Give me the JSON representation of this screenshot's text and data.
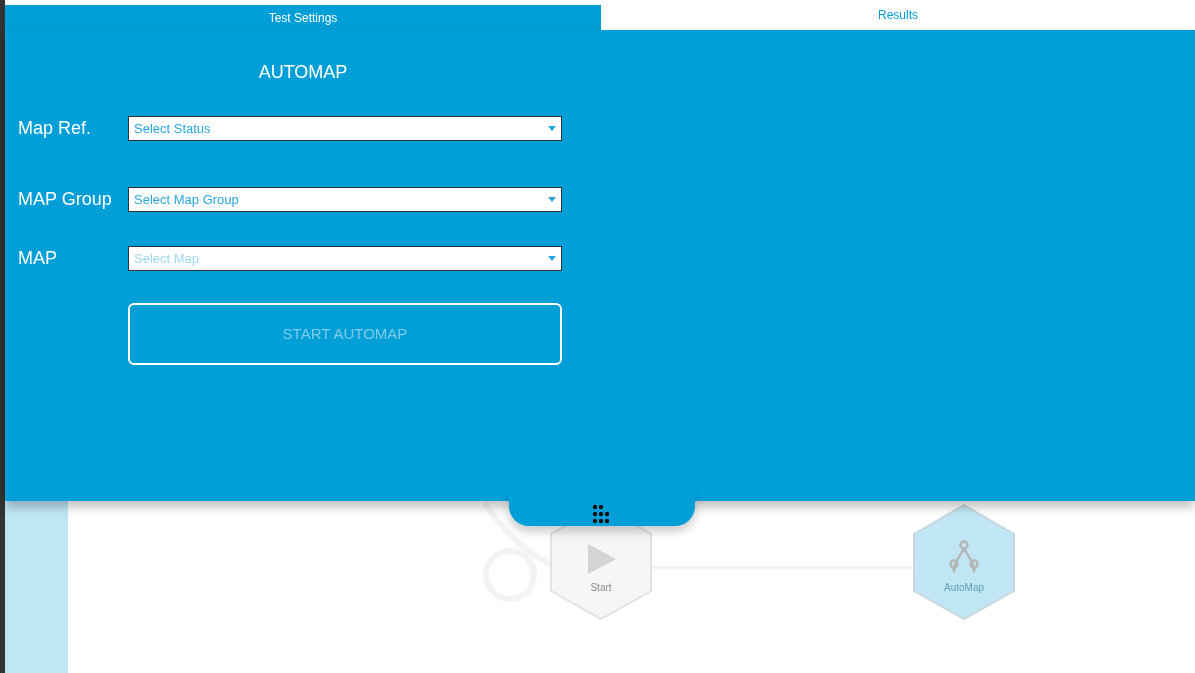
{
  "tabs": [
    {
      "label": "Test Settings",
      "selected": true
    },
    {
      "label": "Results",
      "selected": false
    }
  ],
  "panel": {
    "title": "AUTOMAP",
    "fields": [
      {
        "label": "Map Ref.",
        "placeholder": "Select Status",
        "disabled": false
      },
      {
        "label": "MAP Group",
        "placeholder": "Select Map Group",
        "disabled": false
      },
      {
        "label": "MAP",
        "placeholder": "Select Map",
        "disabled": true
      }
    ],
    "button": {
      "label": "START AUTOMAP",
      "disabled": true
    }
  },
  "canvas": {
    "nodes": [
      {
        "label": "Start",
        "kind": "start",
        "selected": false
      },
      {
        "label": "AutoMap",
        "kind": "automap",
        "selected": true
      }
    ]
  }
}
